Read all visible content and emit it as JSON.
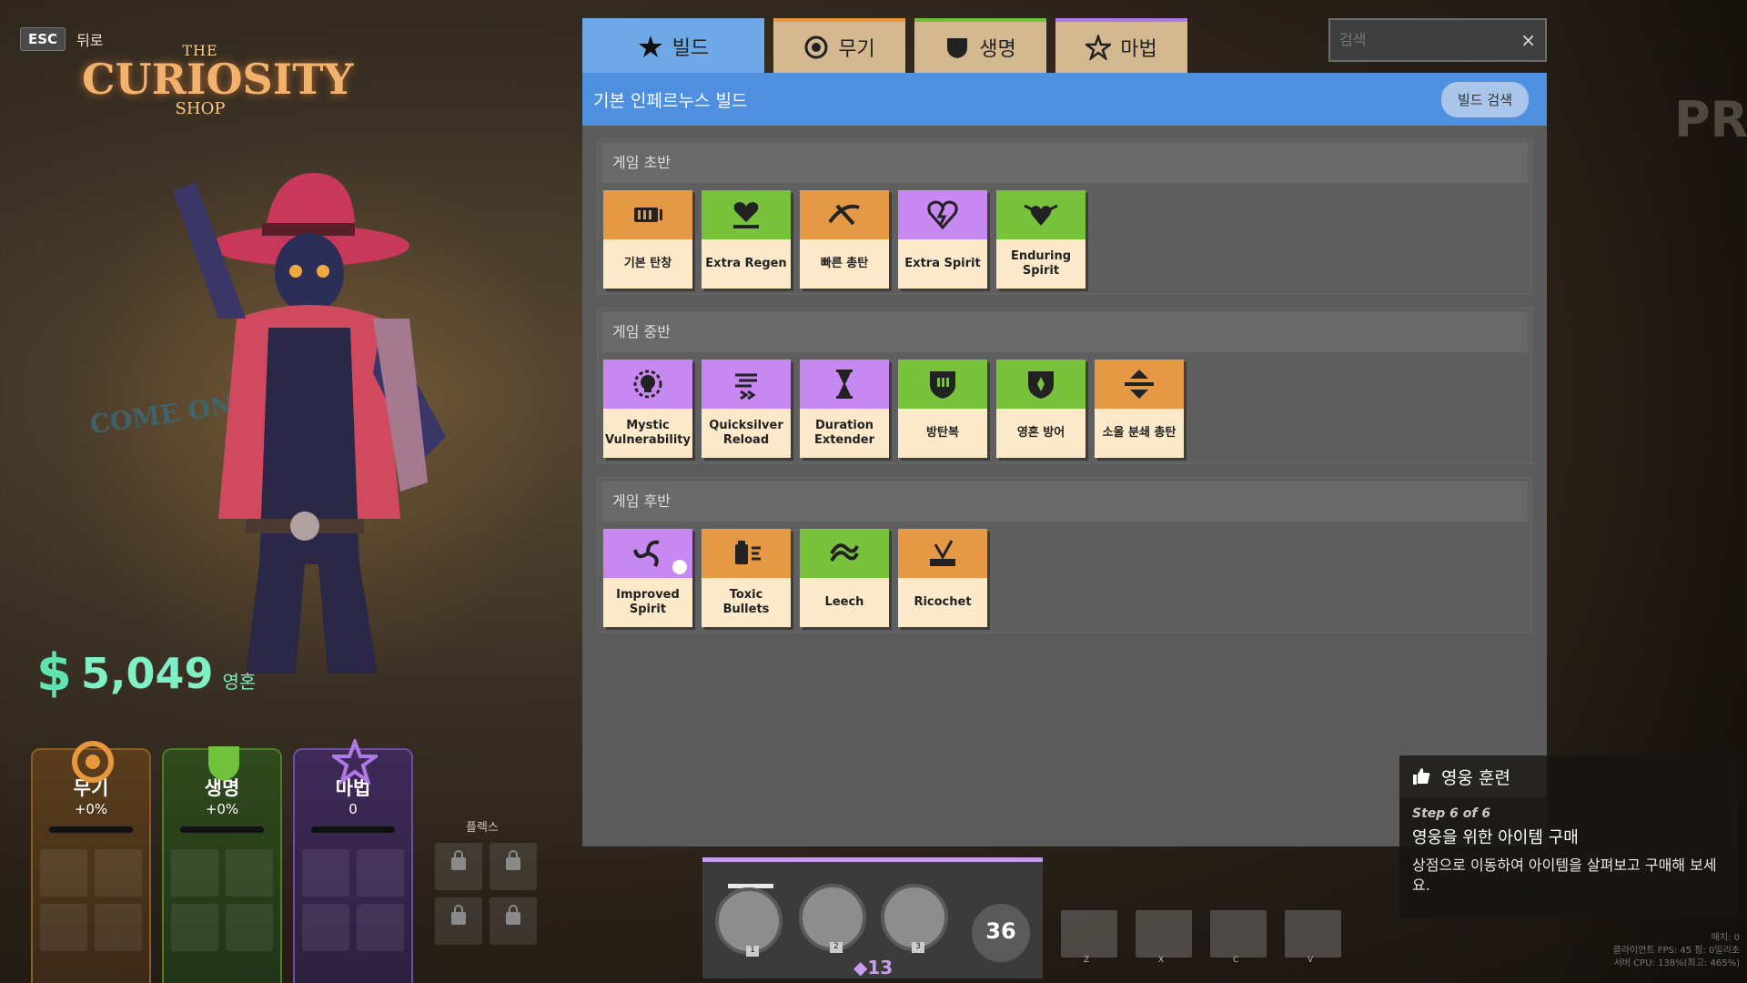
{
  "header": {
    "esc_key": "ESC",
    "back_label": "뒤로",
    "logo_line1": "THE",
    "logo_line2": "CURIOSITY",
    "logo_line3": "SHOP",
    "sign_text": "COME ON IN",
    "bg_letters": "PR"
  },
  "souls": {
    "symbol": "$",
    "amount": "5,049",
    "unit": "영혼"
  },
  "stats": [
    {
      "name": "무기",
      "value": "+0%",
      "color": "#e8973a"
    },
    {
      "name": "생명",
      "value": "+0%",
      "color": "#6fc23a"
    },
    {
      "name": "마법",
      "value": "0",
      "color": "#b07ae6"
    }
  ],
  "flex_label": "플렉스",
  "tabs": [
    {
      "label": "빌드",
      "icon": "star-icon"
    },
    {
      "label": "무기",
      "icon": "weapon-icon"
    },
    {
      "label": "생명",
      "icon": "vitality-icon"
    },
    {
      "label": "마법",
      "icon": "spirit-icon"
    }
  ],
  "search": {
    "placeholder": "검색",
    "clear": "×"
  },
  "build": {
    "title": "기본 인페르누스 빌드",
    "search_button": "빌드 검색"
  },
  "sections": [
    {
      "title": "게임 초반",
      "items": [
        {
          "label": "기본 탄창",
          "color": "orange",
          "icon": "ammo-icon"
        },
        {
          "label": "Extra Regen",
          "color": "green",
          "icon": "heart-regen-icon"
        },
        {
          "label": "빠른 총탄",
          "color": "orange",
          "icon": "bullet-icon"
        },
        {
          "label": "Extra Spirit",
          "color": "purple",
          "icon": "spirit-heart-icon"
        },
        {
          "label": "Enduring Spirit",
          "color": "green",
          "icon": "winged-heart-icon"
        }
      ]
    },
    {
      "title": "게임 중반",
      "items": [
        {
          "label": "Mystic Vulnerability",
          "color": "purple",
          "icon": "skull-icon"
        },
        {
          "label": "Quicksilver Reload",
          "color": "purple",
          "icon": "reload-icon"
        },
        {
          "label": "Duration Extender",
          "color": "purple",
          "icon": "hourglass-icon"
        },
        {
          "label": "방탄복",
          "color": "green",
          "icon": "bullet-armor-icon"
        },
        {
          "label": "영혼 방어",
          "color": "green",
          "icon": "spirit-armor-icon"
        },
        {
          "label": "소울 분쇄 총탄",
          "color": "orange",
          "icon": "shred-icon"
        }
      ]
    },
    {
      "title": "게임 후반",
      "items": [
        {
          "label": "Improved Spirit",
          "color": "purple",
          "icon": "swirl-icon"
        },
        {
          "label": "Toxic Bullets",
          "color": "orange",
          "icon": "toxic-icon"
        },
        {
          "label": "Leech",
          "color": "green",
          "icon": "leech-icon"
        },
        {
          "label": "Ricochet",
          "color": "orange",
          "icon": "ricochet-icon"
        }
      ]
    }
  ],
  "hotbar": {
    "abilities": [
      {
        "key": "1"
      },
      {
        "key": "2"
      },
      {
        "key": "3"
      }
    ],
    "ult_cooldown": "36",
    "ability_points": "◆13"
  },
  "item_slots": [
    {
      "key": "Z"
    },
    {
      "key": "X"
    },
    {
      "key": "C"
    },
    {
      "key": "V"
    }
  ],
  "tutorial": {
    "title": "영웅 훈련",
    "step": "Step 6 of 6",
    "heading": "영웅을 위한 아이템 구매",
    "text": "상점으로 이동하여 아이템을 살펴보고 구매해 보세요."
  },
  "perf": {
    "line1": "매치: 0",
    "line2": "클라이언트 FPS: 45  핑: 0밀리초",
    "line3": "서버 CPU: 138%(최고: 465%)"
  }
}
